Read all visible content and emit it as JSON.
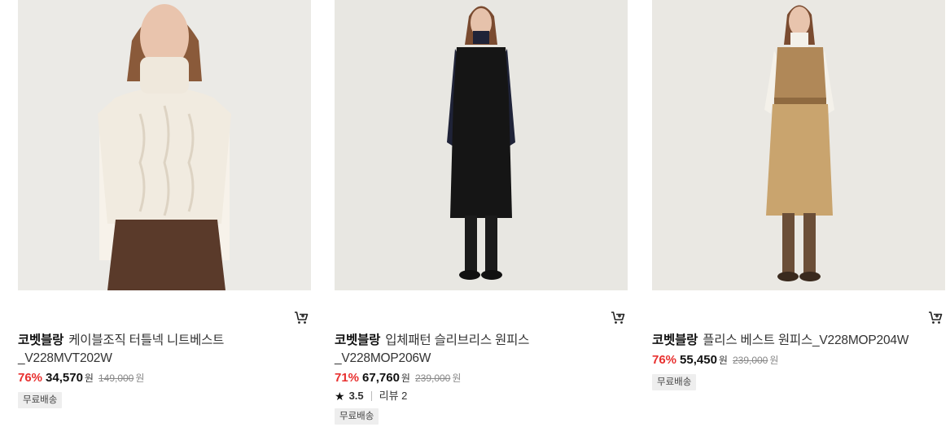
{
  "products": [
    {
      "brand": "코벳블랑",
      "name": "케이블조직 터틀넥 니트베스트",
      "name_line2": "_V228MVT202W",
      "discount": "76%",
      "price": "34,570",
      "currency": "원",
      "original_price": "149,000",
      "original_currency": "원",
      "badge": "무료배송",
      "cart_icon": "cart-add-icon"
    },
    {
      "brand": "코벳블랑",
      "name": "입체패턴 슬리브리스 원피스",
      "name_line2": "_V228MOP206W",
      "discount": "71%",
      "price": "67,760",
      "currency": "원",
      "original_price": "239,000",
      "original_currency": "원",
      "rating": "3.5",
      "review_label": "리뷰 2",
      "badge": "무료배송",
      "cart_icon": "cart-add-icon"
    },
    {
      "brand": "코벳블랑",
      "name": "플리스 베스트 원피스_V228MOP204W",
      "discount": "76%",
      "price": "55,450",
      "currency": "원",
      "original_price": "239,000",
      "original_currency": "원",
      "badge": "무료배송",
      "cart_icon": "cart-add-icon"
    }
  ],
  "colors": {
    "discount": "#e8302f",
    "badge_bg": "#eeeeee",
    "photo_bg": "#ecebe7"
  }
}
